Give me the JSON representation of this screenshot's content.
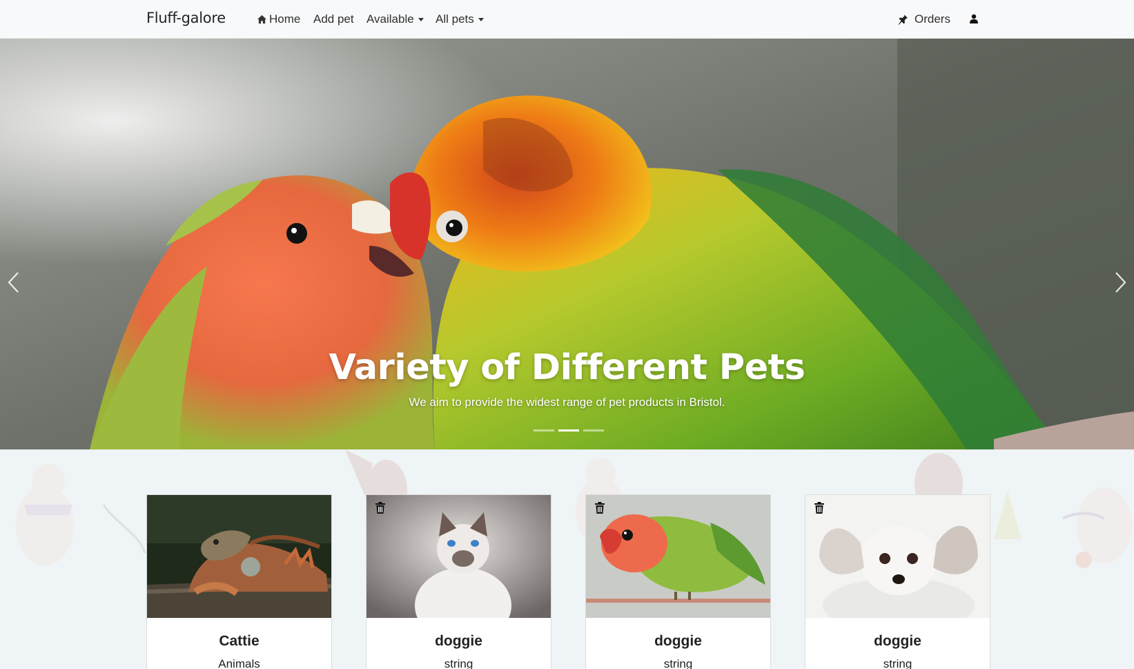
{
  "navbar": {
    "brand": "Fluff-galore",
    "links": [
      {
        "label": "Home",
        "icon": "home-icon"
      },
      {
        "label": "Add pet"
      },
      {
        "label": "Available",
        "dropdown": true
      },
      {
        "label": "All pets",
        "dropdown": true
      }
    ],
    "orders_label": "Orders",
    "orders_icon": "pin-icon",
    "user_icon": "user-icon"
  },
  "hero": {
    "title": "Variety of Different Pets",
    "subtitle": "We aim to provide the widest range of pet products in Bristol.",
    "active_slide": 2,
    "slide_count": 3
  },
  "cards": [
    {
      "name": "Cattie",
      "category": "Animals",
      "image": "iguana"
    },
    {
      "name": "doggie",
      "category": "string",
      "image": "cat"
    },
    {
      "name": "doggie",
      "category": "string",
      "image": "lovebird"
    },
    {
      "name": "doggie",
      "category": "string",
      "image": "small-dog"
    }
  ],
  "colors": {
    "navbar_bg": "#f8f9fa",
    "text": "#212529",
    "content_bg": "#eff4f6"
  }
}
